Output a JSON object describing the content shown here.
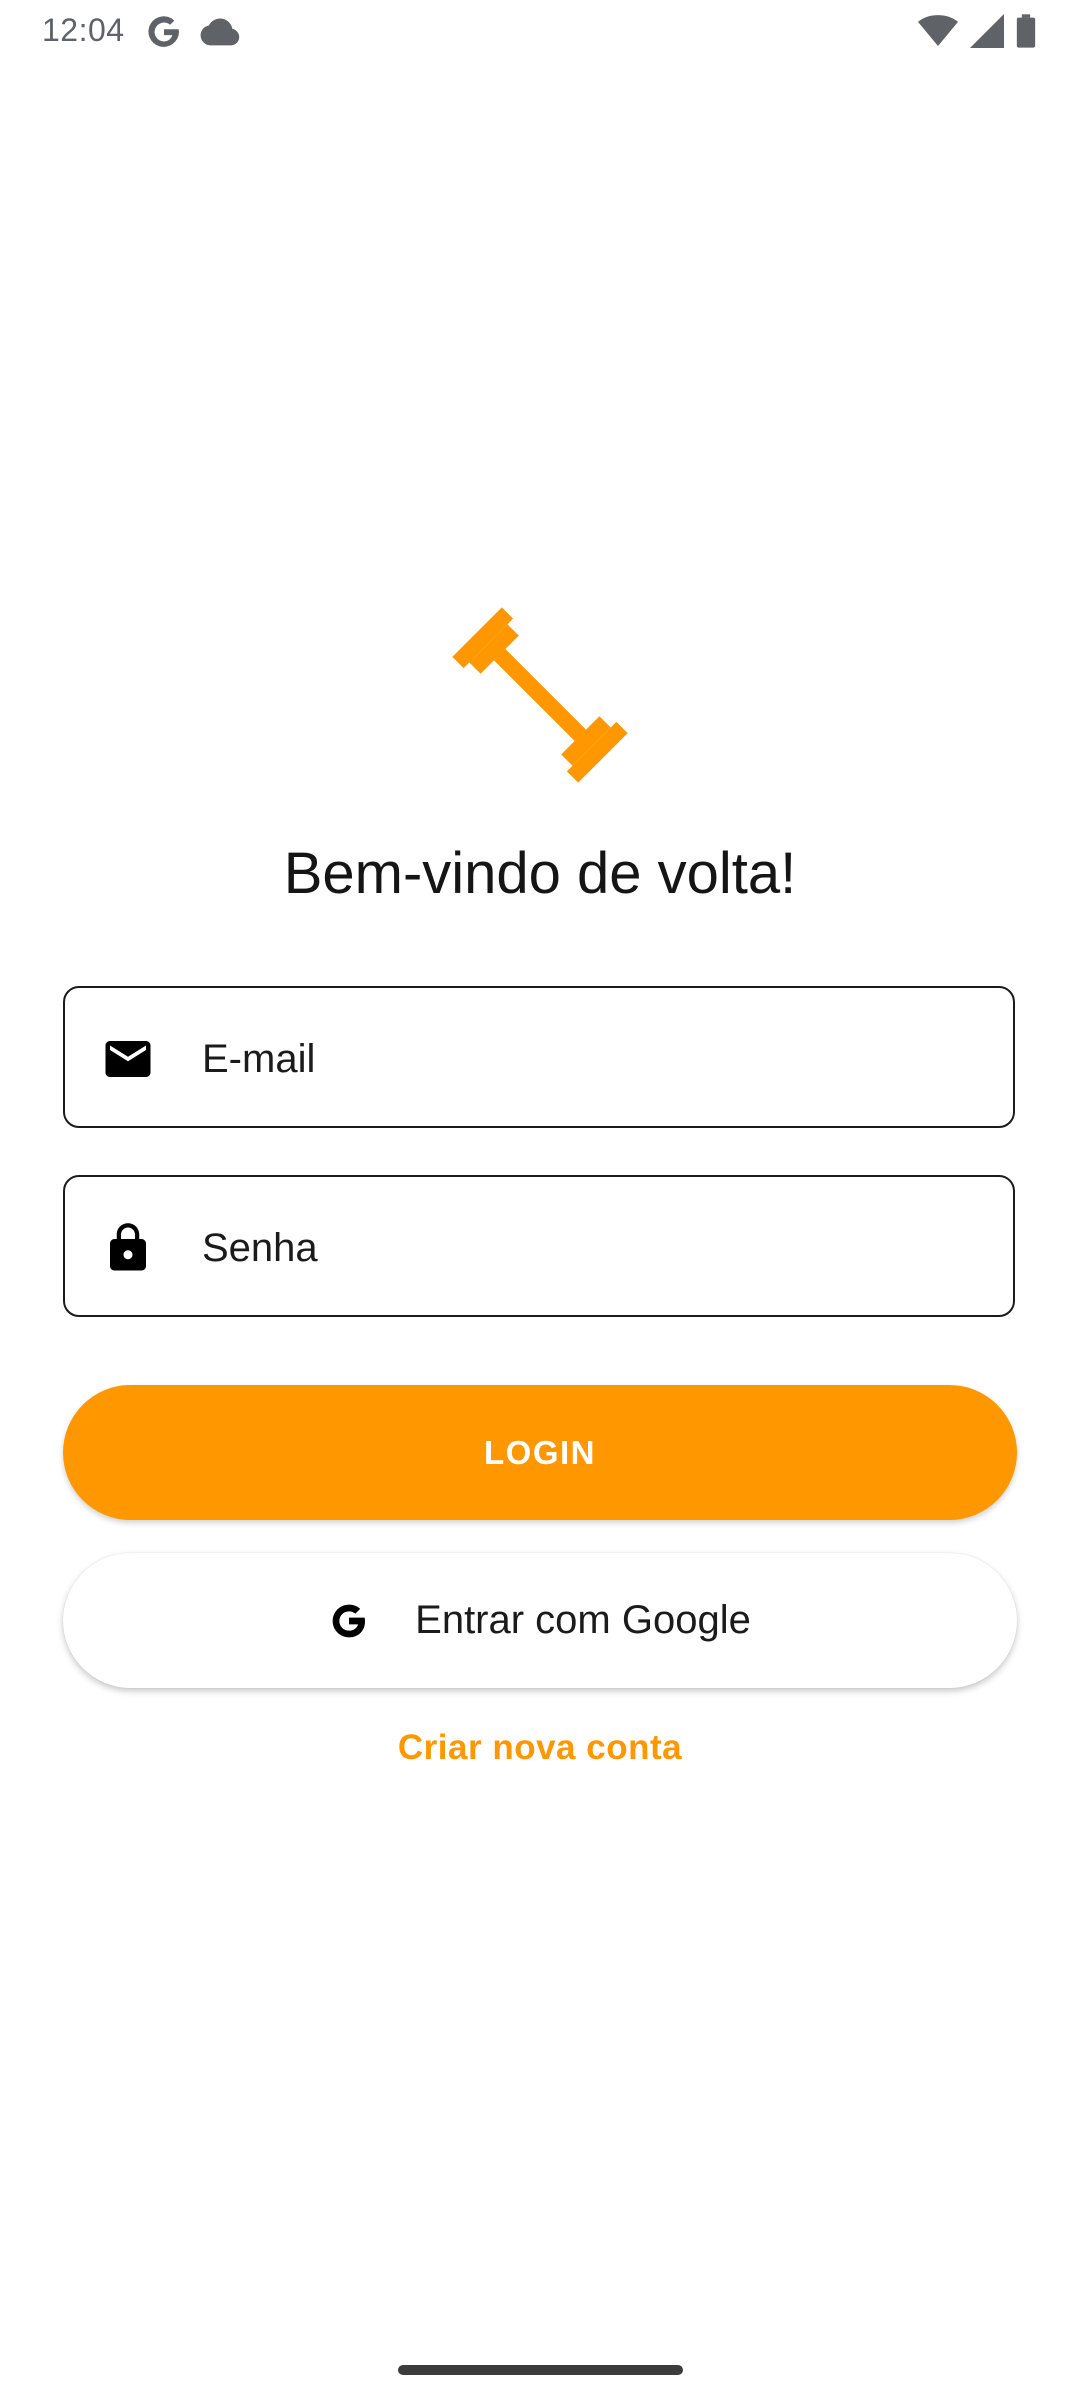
{
  "status_bar": {
    "time": "12:04",
    "left_icons": [
      "google-g-icon",
      "cloud-icon"
    ],
    "right_icons": [
      "wifi-icon",
      "signal-icon",
      "battery-icon"
    ]
  },
  "logo": {
    "icon": "dumbbell-icon",
    "color": "#ff9800"
  },
  "title": "Bem-vindo de volta!",
  "form": {
    "email": {
      "placeholder": "E-mail",
      "icon": "mail-icon"
    },
    "password": {
      "placeholder": "Senha",
      "icon": "lock-icon"
    }
  },
  "buttons": {
    "login_label": "LOGIN",
    "google_label": "Entrar com Google",
    "google_icon": "google-g-icon"
  },
  "links": {
    "create_account": "Criar nova conta"
  },
  "colors": {
    "accent": "#ff9800",
    "text": "#1b1b1b",
    "background": "#ffffff"
  }
}
